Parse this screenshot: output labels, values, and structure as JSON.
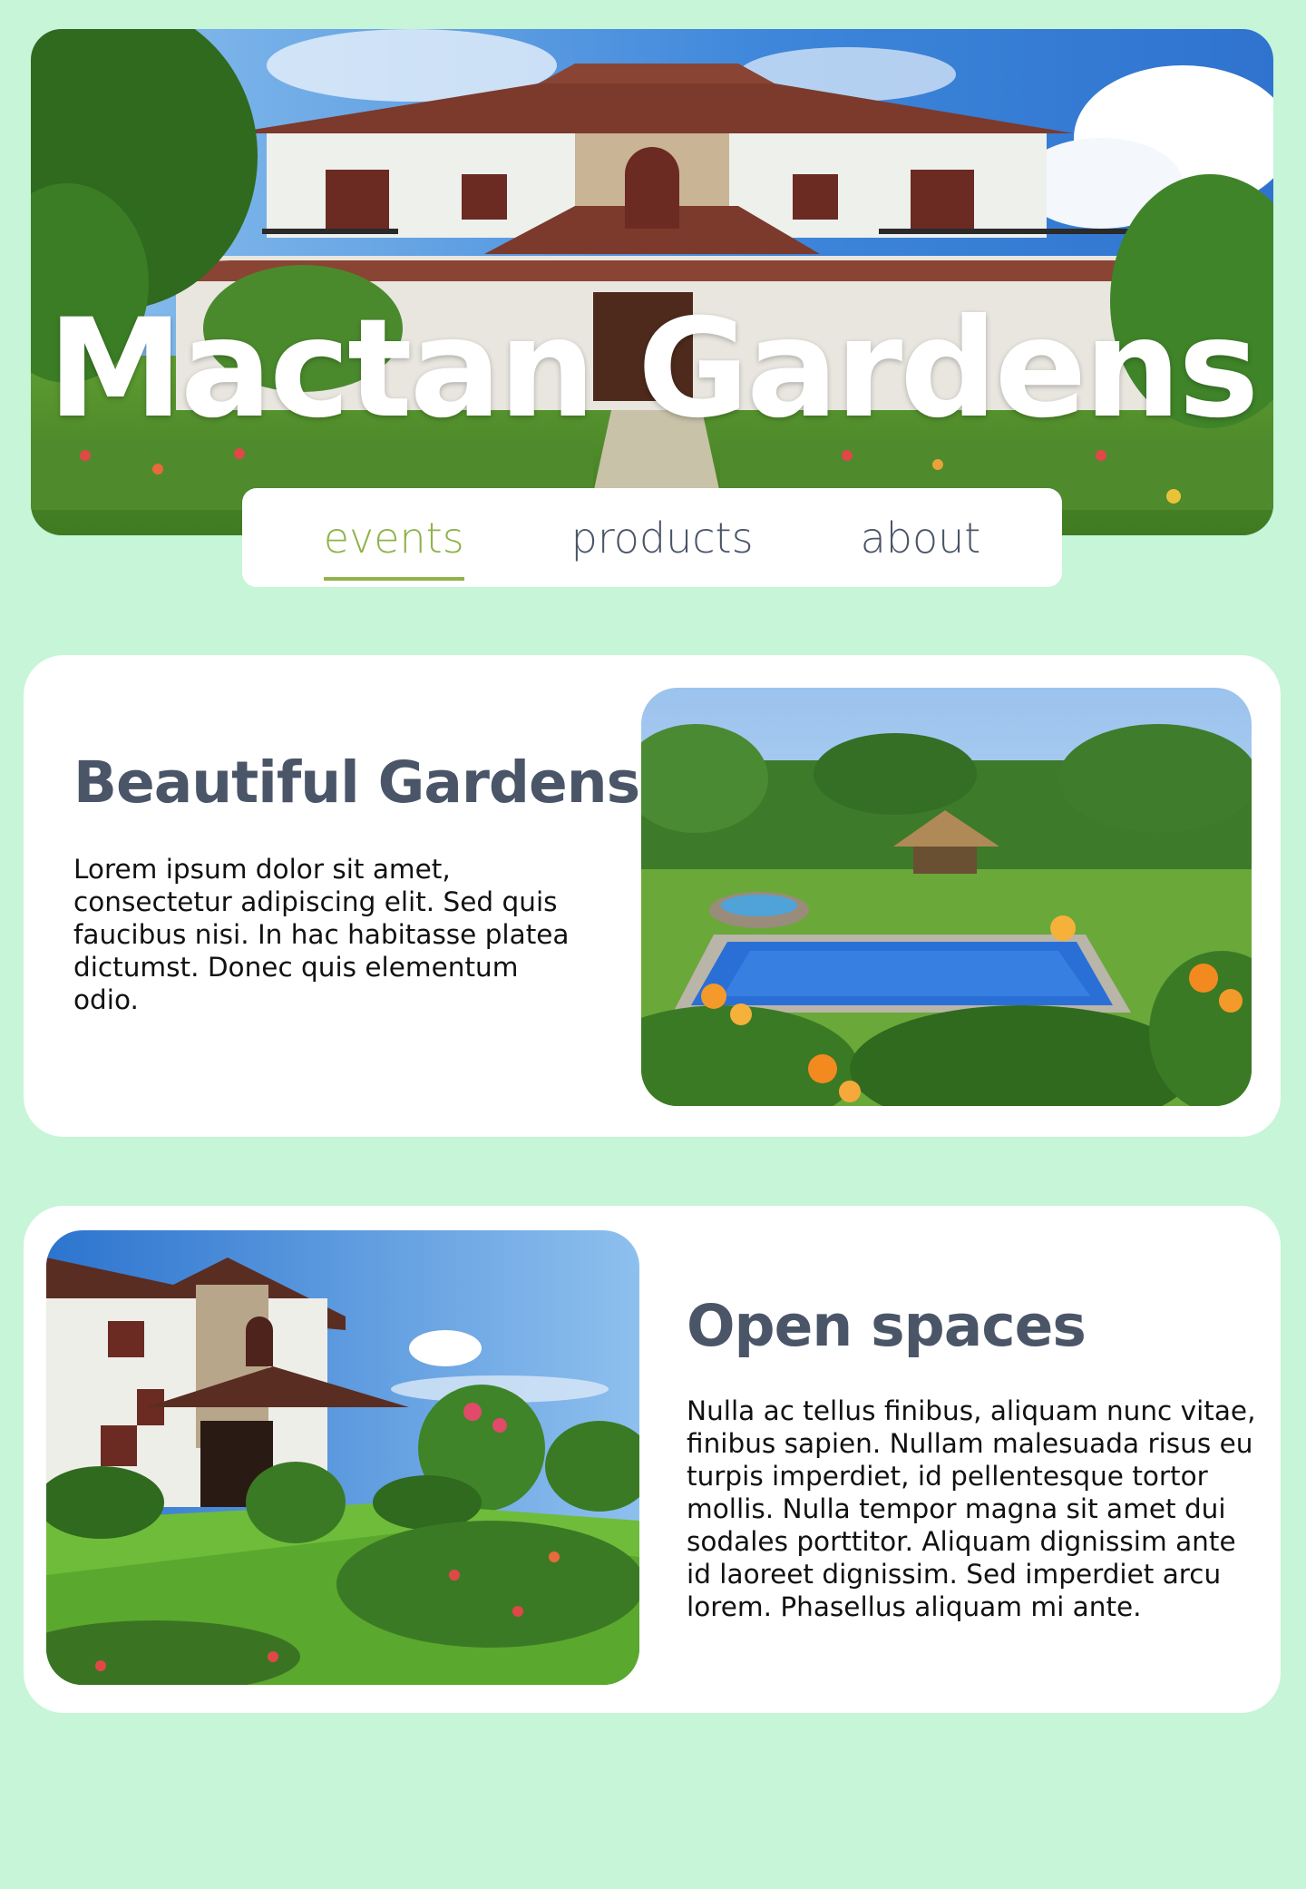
{
  "site": {
    "title": "Mactan Gardens"
  },
  "nav": {
    "items": [
      {
        "label": "events",
        "active": true
      },
      {
        "label": "products",
        "active": false
      },
      {
        "label": "about",
        "active": false
      }
    ],
    "active_color": "#8fb24a",
    "text_color": "#4a5568"
  },
  "sections": [
    {
      "heading": "Beautiful Gardens",
      "body": "Lorem ipsum dolor sit amet, consectetur adipiscing elit. Sed quis faucibus nisi. In hac habitasse platea dictumst. Donec quis elementum odio.",
      "image": "garden-pool-photo"
    },
    {
      "heading": "Open spaces",
      "body": "Nulla ac tellus finibus, aliquam nunc vitae, finibus sapien. Nullam malesuada risus eu turpis imperdiet, id pellentesque tortor mollis. Nulla tempor magna sit amet dui sodales porttitor. Aliquam dignissim ante id laoreet dignissim. Sed imperdiet arcu lorem. Phasellus aliquam mi ante.",
      "image": "villa-lawn-photo"
    }
  ],
  "colors": {
    "page_background": "#c6f5d7",
    "card_background": "#ffffff",
    "heading": "#4a5568"
  }
}
